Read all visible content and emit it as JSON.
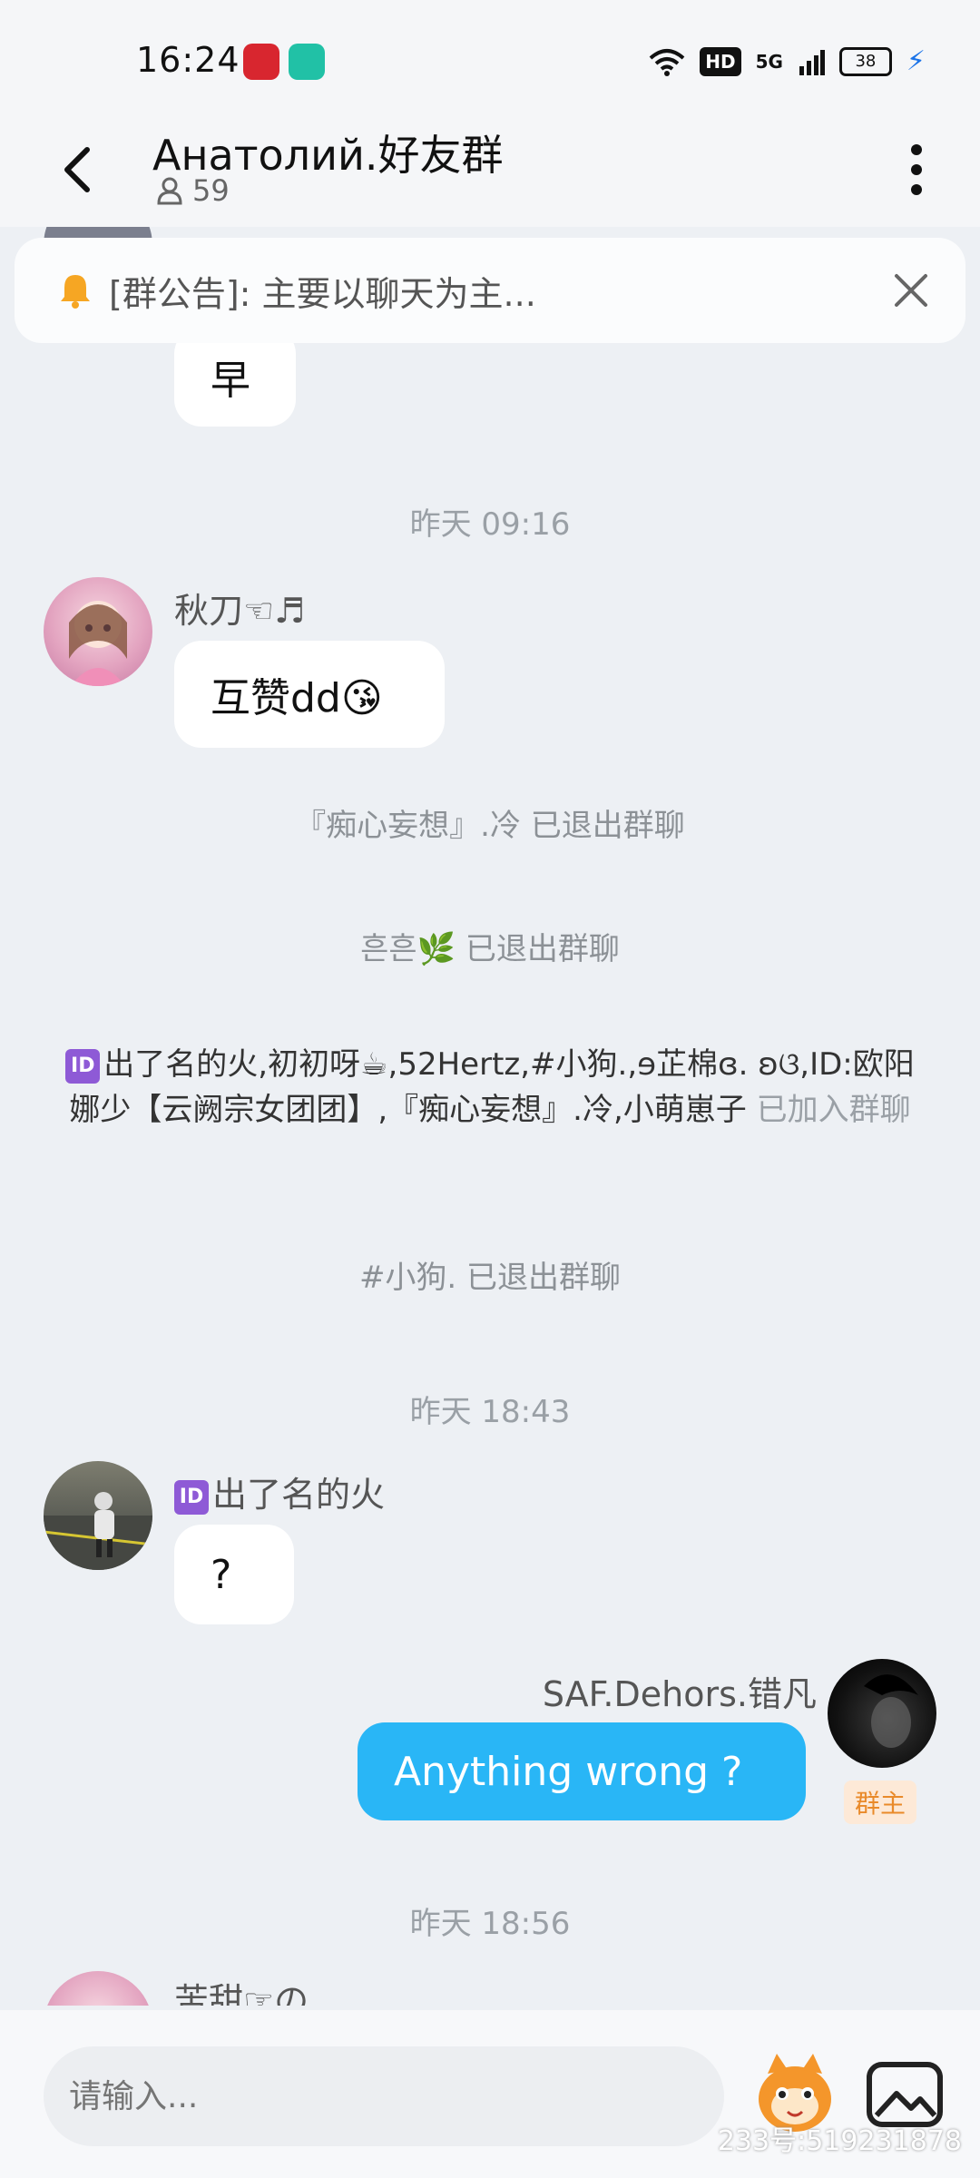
{
  "status_bar": {
    "time": "16:24",
    "hd": "HD",
    "network": "5G",
    "battery": "38"
  },
  "header": {
    "title": "Анатолий.好友群",
    "member_count": "59"
  },
  "announcement": {
    "text": "[群公告]: 主要以聊天为主..."
  },
  "messages": {
    "m1": {
      "text": "早"
    },
    "ts1": "昨天 09:16",
    "m2": {
      "sender": "秋刀☜♬",
      "text": "互赞dd😘"
    },
    "sys1": "『痴心妄想』.冷 已退出群聊",
    "sys2": "흔흔🌿 已退出群聊",
    "join": {
      "id_badge": "ID",
      "names": "出了名的火,初初呀☕,52Hertz,#小狗.,ɘ芷棉ɞ. ʚଓ,ID:欧阳娜少【云阙宗女团团】,『痴心妄想』.冷,小萌崽子",
      "suffix": " 已加入群聊"
    },
    "sys3": "#小狗. 已退出群聊",
    "ts2": "昨天 18:43",
    "m3": {
      "id_badge": "ID",
      "sender": "出了名的火",
      "text": "?"
    },
    "m4": {
      "sender": "SAF.Dehors.错凡",
      "text": "Anything wrong ?",
      "role": "群主"
    },
    "ts3": "昨天 18:56",
    "m5": {
      "sender": "苦甜☞の"
    }
  },
  "input_bar": {
    "placeholder": "请输入..."
  },
  "watermark": "233号:519231878",
  "colors": {
    "accent": "#29b6f6",
    "background": "#edf0f4",
    "role_badge": "#e98a2a"
  }
}
